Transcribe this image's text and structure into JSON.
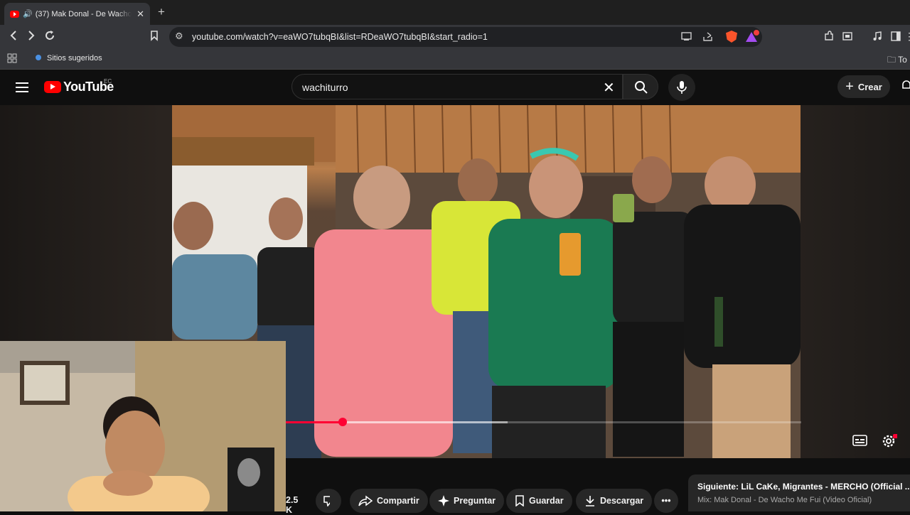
{
  "browser": {
    "tab_title": "(37) Mak Donal - De Wacho M",
    "tab_sound_icon": "speaker-icon",
    "url": "youtube.com/watch?v=eaWO7tubqBI&list=RDeaWO7tubqBI&start_radio=1",
    "bookmark_suggested": "Sitios sugeridos",
    "bookmark_right": "To",
    "new_tab_label": "+"
  },
  "youtube": {
    "logo_text": "YouTube",
    "country_code": "EC",
    "search_value": "wachiturro",
    "create_label": "Crear",
    "colors": {
      "brand_red": "#ff0000",
      "progress_red": "#ff0033",
      "background": "#0f0f0f"
    }
  },
  "player": {
    "progress_fraction": 0.11,
    "buffered_fraction": 0.43
  },
  "actions": {
    "like_count": "2.5 K",
    "share_label": "Compartir",
    "ask_label": "Preguntar",
    "save_label": "Guardar",
    "download_label": "Descargar"
  },
  "up_next": {
    "title": "Siguiente: LiL CaKe, Migrantes - MERCHO (Official ...",
    "subtitle": "Mix: Mak Donal - De Wacho Me Fui (Video Oficial)"
  }
}
